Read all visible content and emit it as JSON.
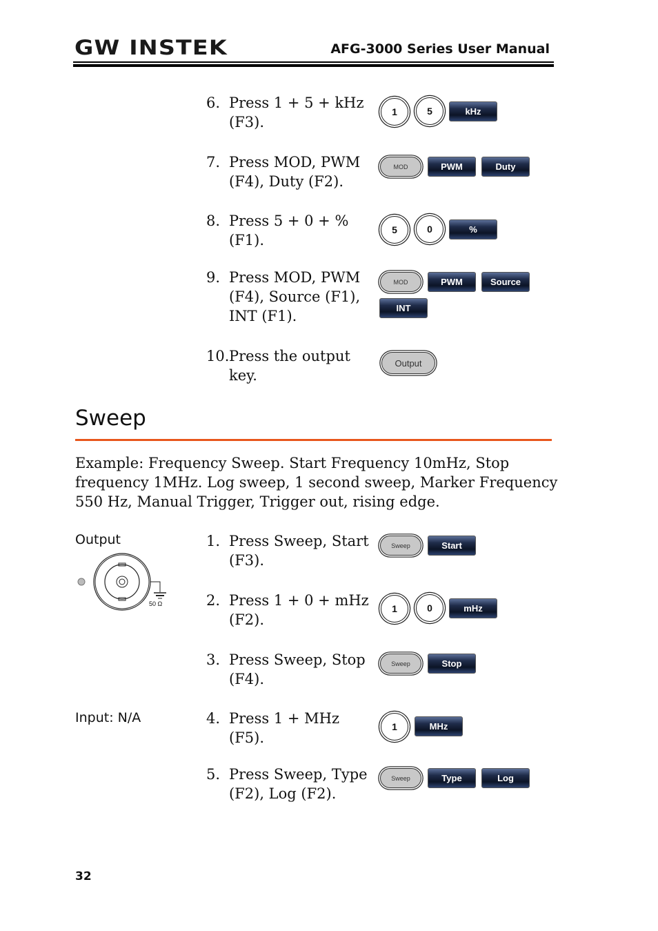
{
  "header": {
    "logo": "GW INSTEK",
    "title": "AFG-3000 Series User Manual"
  },
  "steps_a": [
    {
      "n": "6.",
      "text": "Press 1 + 5 + kHz (F3).",
      "keys": [
        "1",
        "5",
        "kHz"
      ]
    },
    {
      "n": "7.",
      "text": "Press MOD, PWM (F4), Duty (F2).",
      "keys": [
        "MOD",
        "PWM",
        "Duty"
      ]
    },
    {
      "n": "8.",
      "text": "Press 5 + 0 + % (F1).",
      "keys": [
        "5",
        "0",
        "%"
      ]
    },
    {
      "n": "9.",
      "text": "Press MOD, PWM (F4), Source (F1), INT (F1).",
      "keys": [
        "MOD",
        "PWM",
        "Source",
        "INT"
      ]
    },
    {
      "n": "10.",
      "text": "Press the output key.",
      "keys": [
        "Output"
      ]
    }
  ],
  "section": {
    "title": "Sweep",
    "accent": "#e8561c",
    "example": "Example: Frequency Sweep. Start Frequency 10mHz, Stop frequency 1MHz. Log sweep, 1 second sweep, Marker Frequency 550 Hz, Manual Trigger, Trigger out, rising edge."
  },
  "side": {
    "output_label": "Output",
    "impedance": "50 Ω",
    "input_label": "Input: N/A"
  },
  "steps_b": [
    {
      "n": "1.",
      "text": "Press Sweep, Start (F3).",
      "keys": [
        "Sweep",
        "Start"
      ]
    },
    {
      "n": "2.",
      "text": "Press 1 + 0 + mHz (F2).",
      "keys": [
        "1",
        "0",
        "mHz"
      ]
    },
    {
      "n": "3.",
      "text": "Press Sweep, Stop (F4).",
      "keys": [
        "Sweep",
        "Stop"
      ]
    },
    {
      "n": "4.",
      "text": "Press 1 + MHz (F5).",
      "keys": [
        "1",
        "MHz"
      ]
    },
    {
      "n": "5.",
      "text": "Press Sweep, Type (F2), Log (F2).",
      "keys": [
        "Sweep",
        "Type",
        "Log"
      ]
    }
  ],
  "page_number": "32"
}
